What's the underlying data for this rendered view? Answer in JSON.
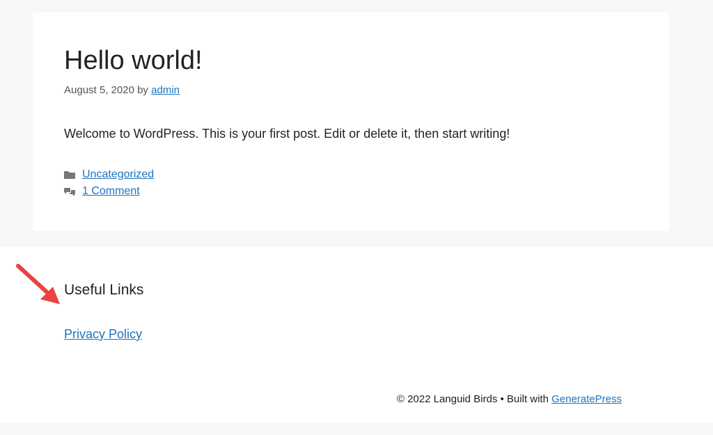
{
  "post": {
    "title": "Hello world!",
    "date": "August 5, 2020",
    "by": "by",
    "author": "admin",
    "content": "Welcome to WordPress. This is your first post. Edit or delete it, then start writing!",
    "category": "Uncategorized",
    "comments": "1 Comment",
    "category_icon": "folder-icon",
    "comments_icon": "comments-icon"
  },
  "widget": {
    "title": "Useful Links",
    "link": "Privacy Policy"
  },
  "footer": {
    "copyright": "© 2022 Languid Birds • Built with",
    "builder_link": "GeneratePress"
  },
  "colors": {
    "link": "#1e73be",
    "background": "#f6f7f8",
    "arrow": "#e8433f"
  }
}
